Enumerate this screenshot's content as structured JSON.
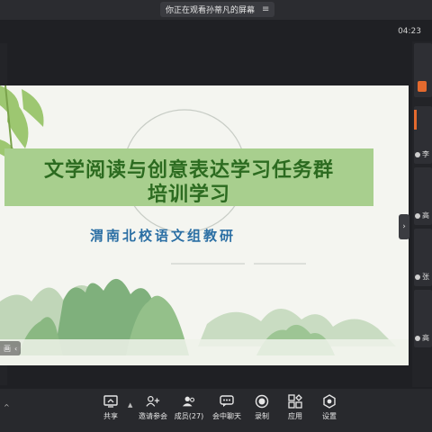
{
  "header": {
    "viewing_notice": "你正在观看孙蒂凡的屏幕",
    "time": "04:23"
  },
  "slide": {
    "title_line1": "文学阅读与创意表达学习任务群",
    "title_line2": "培训学习",
    "subtitle": "渭南北校语文组教研",
    "page_ctrl_label": "画"
  },
  "participants": [
    {
      "name": "李"
    },
    {
      "name": "高"
    },
    {
      "name": "张"
    },
    {
      "name": "高"
    }
  ],
  "toolbar": {
    "share": "共享",
    "invite": "邀请参会",
    "members": "成员(27)",
    "chat": "会中聊天",
    "record": "录制",
    "apps": "应用",
    "settings": "设置"
  },
  "colors": {
    "accent": "#e46a2e",
    "title_bg": "#a8cf8e",
    "title_text": "#2c6b20",
    "subtitle_text": "#2b6fa4"
  }
}
